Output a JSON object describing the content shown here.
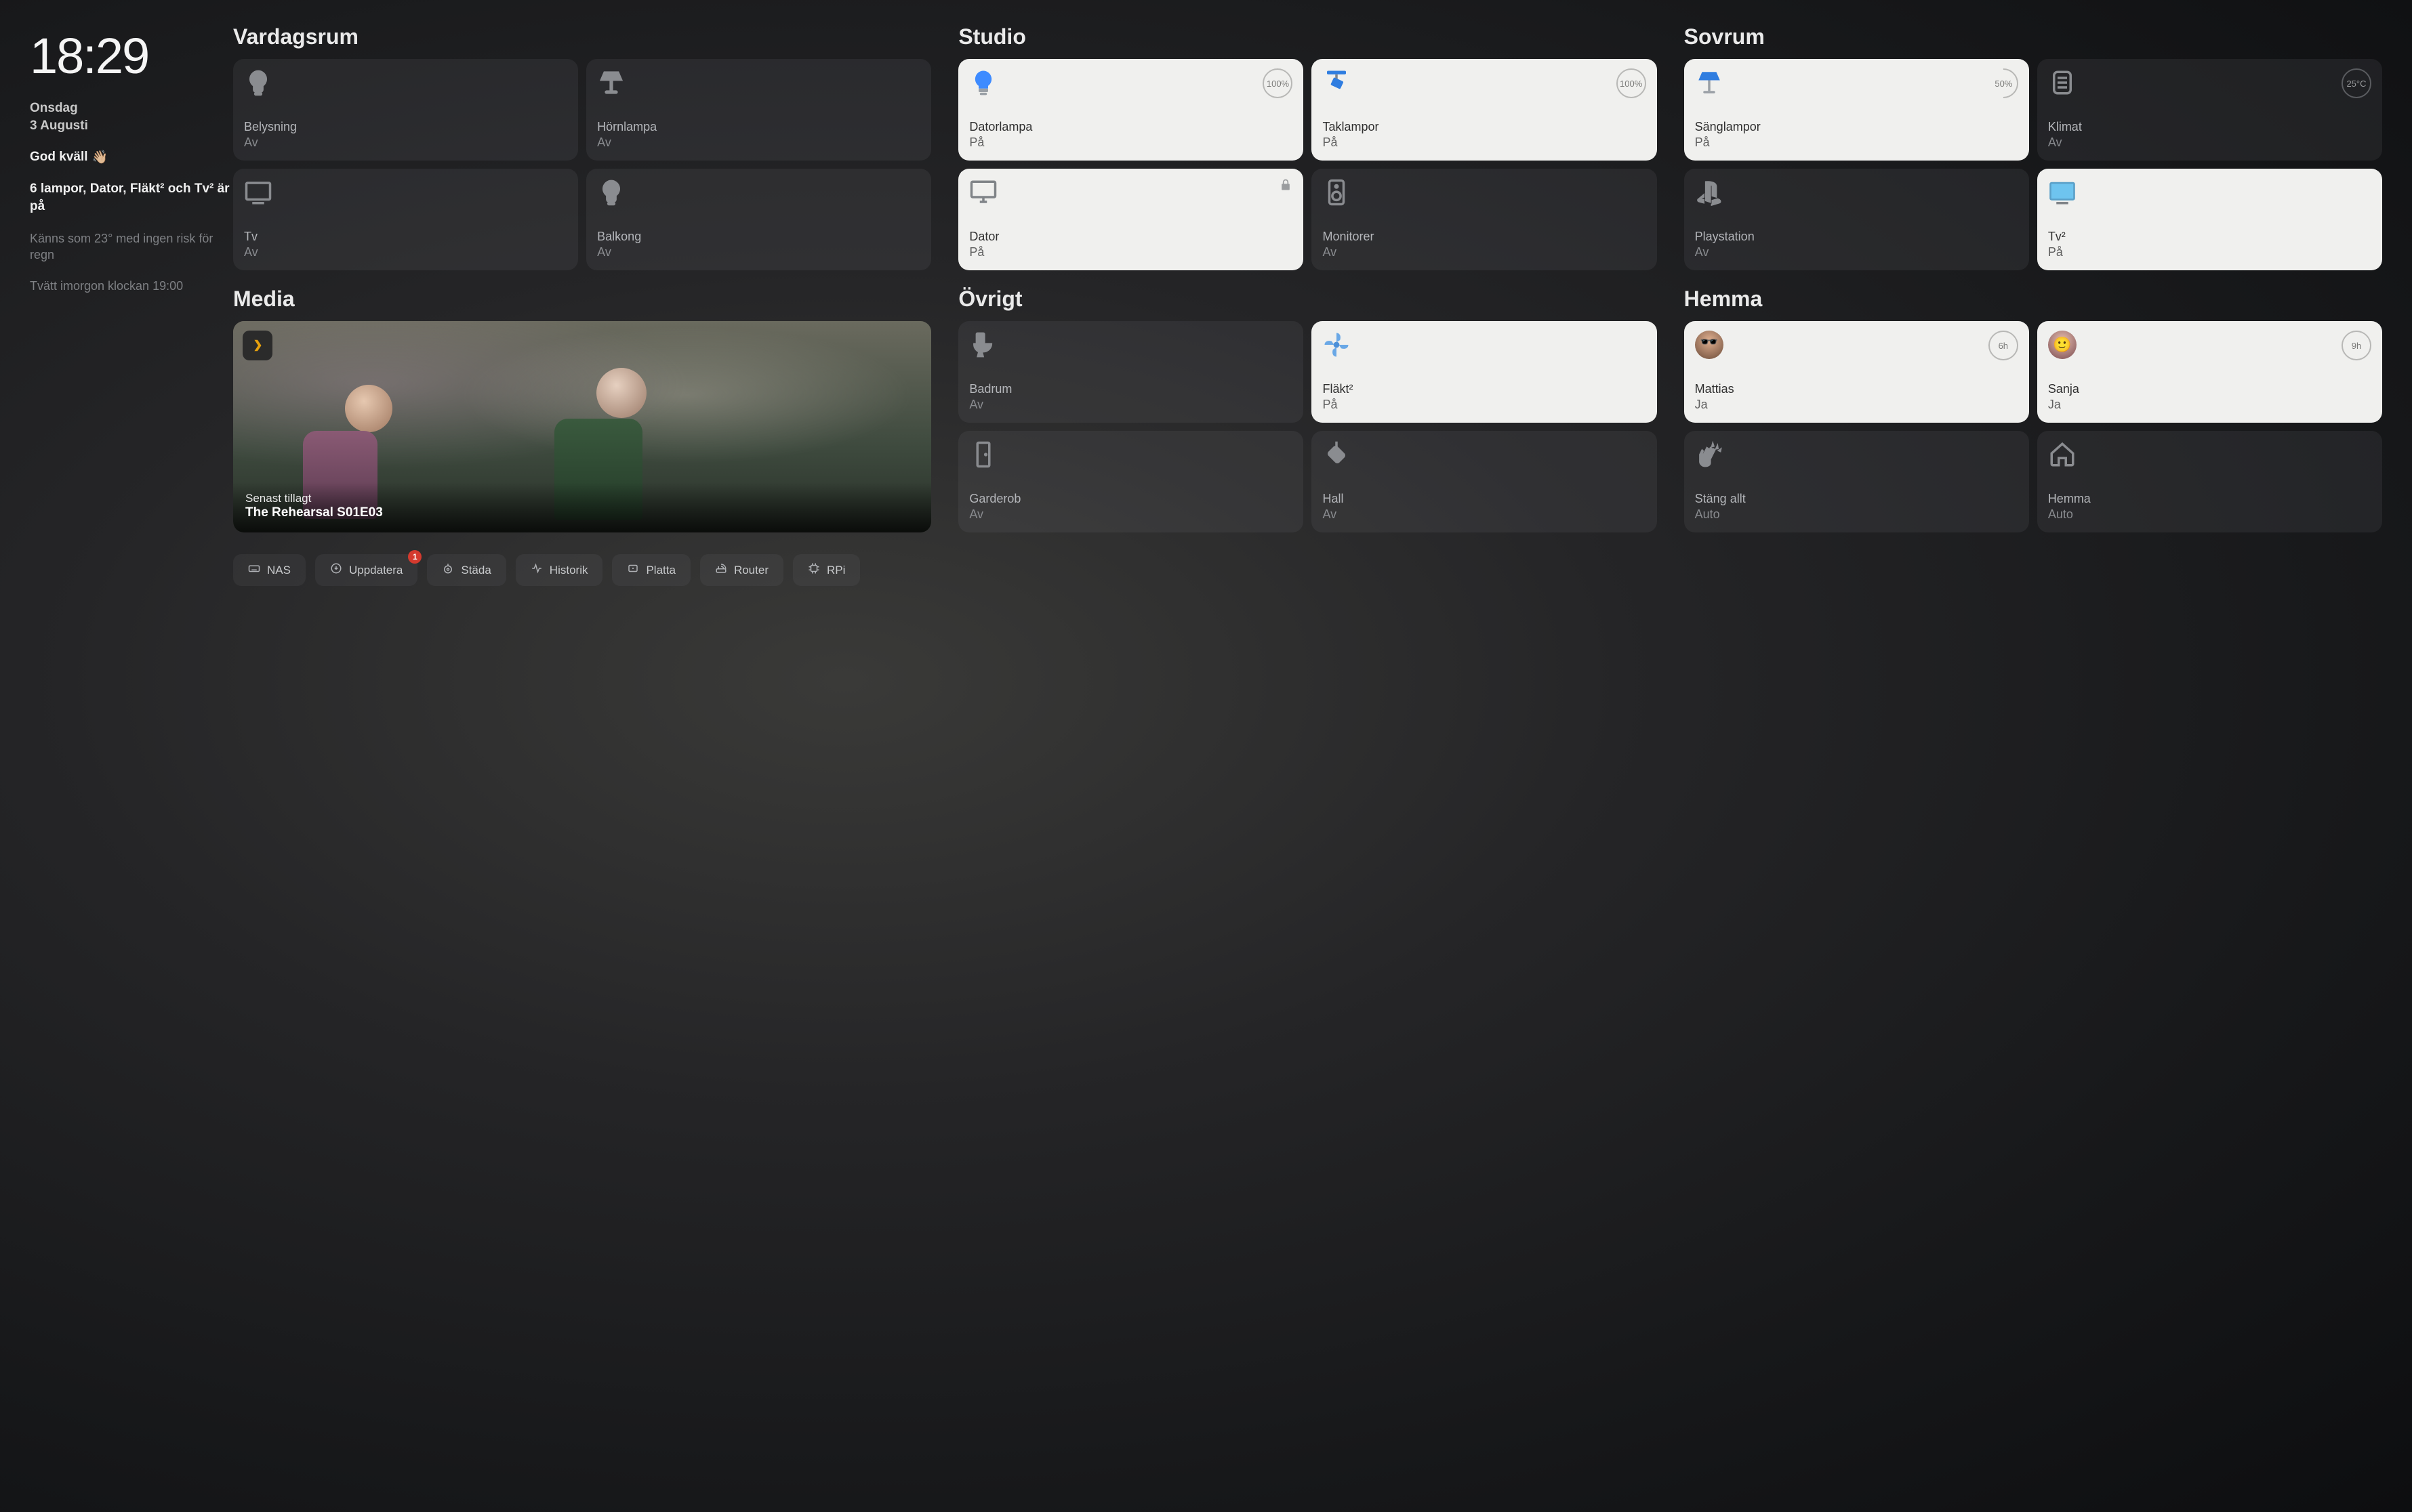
{
  "sidebar": {
    "time": "18:29",
    "dayOfWeek": "Onsdag",
    "date": "3 Augusti",
    "greeting": "God kväll",
    "greetingEmoji": "👋🏼",
    "summary": "6 lampor, Dator, Fläkt² och Tv² är på",
    "weather": "Känns som 23° med ingen risk för regn",
    "laundry": "Tvätt imorgon klockan 19:00"
  },
  "rooms": {
    "vardagsrum": {
      "title": "Vardagsrum",
      "tiles": [
        {
          "id": "belysning",
          "name": "Belysning",
          "state": "Av",
          "on": false,
          "icon": "bulb"
        },
        {
          "id": "hornlampa",
          "name": "Hörnlampa",
          "state": "Av",
          "on": false,
          "icon": "lamp-shade"
        },
        {
          "id": "tv",
          "name": "Tv",
          "state": "Av",
          "on": false,
          "icon": "tv"
        },
        {
          "id": "balkong",
          "name": "Balkong",
          "state": "Av",
          "on": false,
          "icon": "bulb"
        }
      ]
    },
    "studio": {
      "title": "Studio",
      "tiles": [
        {
          "id": "datorlampa",
          "name": "Datorlampa",
          "state": "På",
          "on": true,
          "icon": "bulb-color",
          "badge": "100%"
        },
        {
          "id": "taklampor",
          "name": "Taklampor",
          "state": "På",
          "on": true,
          "icon": "spotlight",
          "badge": "100%"
        },
        {
          "id": "dator",
          "name": "Dator",
          "state": "På",
          "on": true,
          "icon": "imac",
          "lock": true
        },
        {
          "id": "monitorer",
          "name": "Monitorer",
          "state": "Av",
          "on": false,
          "icon": "speaker"
        }
      ]
    },
    "sovrum": {
      "title": "Sovrum",
      "tiles": [
        {
          "id": "sanglampor",
          "name": "Sänglampor",
          "state": "På",
          "on": true,
          "icon": "lamp-shade-color",
          "badge": "50%",
          "badgeHalf": true
        },
        {
          "id": "klimat",
          "name": "Klimat",
          "state": "Av",
          "on": false,
          "icon": "airwave",
          "badge": "25°C"
        },
        {
          "id": "playstation",
          "name": "Playstation",
          "state": "Av",
          "on": false,
          "icon": "playstation"
        },
        {
          "id": "tv2",
          "name": "Tv²",
          "state": "På",
          "on": true,
          "icon": "tv-on"
        }
      ]
    },
    "ovrigt": {
      "title": "Övrigt",
      "tiles": [
        {
          "id": "badrum",
          "name": "Badrum",
          "state": "Av",
          "on": false,
          "icon": "toilet"
        },
        {
          "id": "flakt2",
          "name": "Fläkt²",
          "state": "På",
          "on": true,
          "icon": "fan"
        },
        {
          "id": "garderob",
          "name": "Garderob",
          "state": "Av",
          "on": false,
          "icon": "door"
        },
        {
          "id": "hall",
          "name": "Hall",
          "state": "Av",
          "on": false,
          "icon": "pendant"
        }
      ]
    },
    "hemma": {
      "title": "Hemma",
      "tiles": [
        {
          "id": "mattias",
          "name": "Mattias",
          "state": "Ja",
          "on": true,
          "icon": "avatar-m",
          "badge": "6h"
        },
        {
          "id": "sanja",
          "name": "Sanja",
          "state": "Ja",
          "on": true,
          "icon": "avatar-f",
          "badge": "9h"
        },
        {
          "id": "stangallt",
          "name": "Stäng allt",
          "state": "Auto",
          "on": false,
          "icon": "clap"
        },
        {
          "id": "hemmaauto",
          "name": "Hemma",
          "state": "Auto",
          "on": false,
          "icon": "house"
        }
      ]
    }
  },
  "media": {
    "title": "Media",
    "sublabel": "Senast tillagt",
    "item": "The Rehearsal S01E03",
    "sourceIcon": "plex"
  },
  "bottomBar": [
    {
      "id": "nas",
      "label": "NAS",
      "icon": "keyboard"
    },
    {
      "id": "uppdatera",
      "label": "Uppdatera",
      "icon": "download-circle",
      "notif": "1"
    },
    {
      "id": "stada",
      "label": "Städa",
      "icon": "vacuum"
    },
    {
      "id": "historik",
      "label": "Historik",
      "icon": "pulse"
    },
    {
      "id": "platta",
      "label": "Platta",
      "icon": "tablet"
    },
    {
      "id": "router",
      "label": "Router",
      "icon": "router"
    },
    {
      "id": "rpi",
      "label": "RPi",
      "icon": "chip"
    }
  ]
}
